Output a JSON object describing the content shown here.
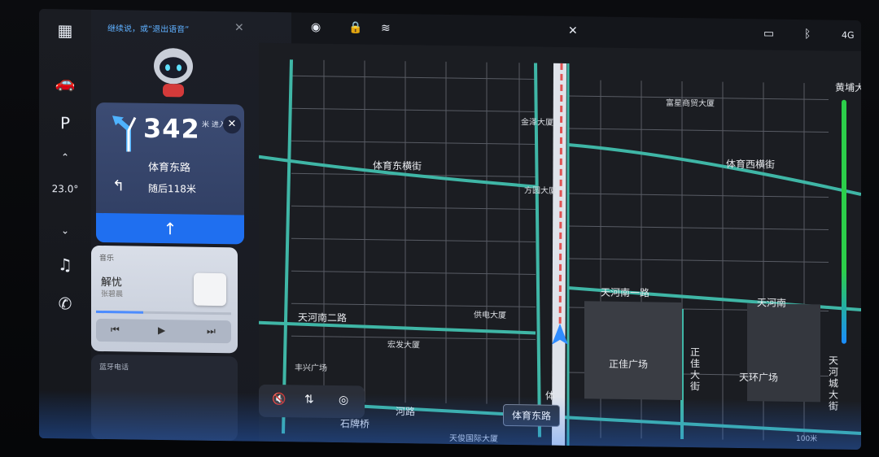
{
  "voice_hint": "继续说，或“退出语音”",
  "rail": {
    "temperature": "23.0°"
  },
  "navigation": {
    "distance": "342",
    "unit": "米 进入",
    "road": "体育东路",
    "next_instruction": "随后118米"
  },
  "music": {
    "header": "音乐",
    "song": "解忧",
    "artist": "张碧晨"
  },
  "phone": {
    "header": "蓝牙电话"
  },
  "status": {
    "network": "4G"
  },
  "map": {
    "current_road": "体育东路",
    "scale": "100米",
    "labels": [
      "黄埔大道",
      "富星商贸大厦",
      "金泽大厦",
      "体育东横街",
      "体育西横街",
      "方圆大厦",
      "天河南一路",
      "天河南",
      "天河南二路",
      "供电大厦",
      "宏发大厦",
      "丰兴广场",
      "正佳广场",
      "正佳大街",
      "天环广场",
      "天河城大街",
      "石牌桥",
      "天俊国际大厦",
      "河路",
      "体"
    ]
  }
}
